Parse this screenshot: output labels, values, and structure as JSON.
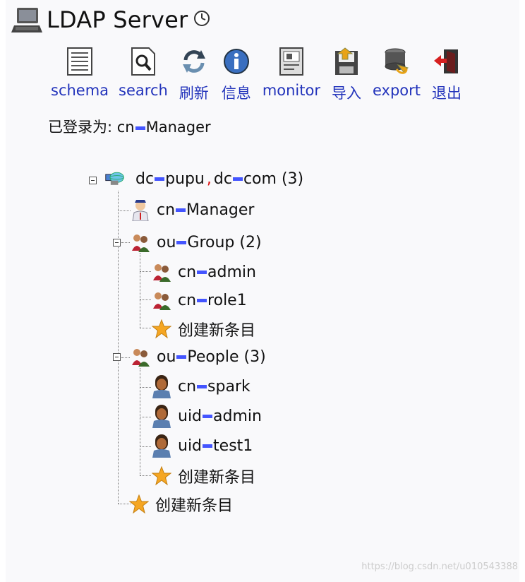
{
  "header": {
    "title": "LDAP Server"
  },
  "toolbar": {
    "items": [
      {
        "label": "schema",
        "icon": "schema-icon"
      },
      {
        "label": "search",
        "icon": "search-icon"
      },
      {
        "label": "刷新",
        "icon": "refresh-icon"
      },
      {
        "label": "信息",
        "icon": "info-icon"
      },
      {
        "label": "monitor",
        "icon": "monitor-icon"
      },
      {
        "label": "导入",
        "icon": "import-icon"
      },
      {
        "label": "export",
        "icon": "export-icon"
      },
      {
        "label": "退出",
        "icon": "logout-icon"
      }
    ]
  },
  "session": {
    "prefix": "已登录为: ",
    "user_attr": "cn",
    "user_value": "Manager"
  },
  "tree": {
    "root": {
      "attr1": "dc",
      "val1": "pupu",
      "attr2": "dc",
      "val2": "com",
      "count": "(3)"
    },
    "manager": {
      "attr": "cn",
      "value": "Manager"
    },
    "group": {
      "attr": "ou",
      "value": "Group",
      "count": "(2)"
    },
    "group_admin": {
      "attr": "cn",
      "value": "admin"
    },
    "group_role1": {
      "attr": "cn",
      "value": "role1"
    },
    "people": {
      "attr": "ou",
      "value": "People",
      "count": "(3)"
    },
    "people_spark": {
      "attr": "cn",
      "value": "spark"
    },
    "people_admin": {
      "attr": "uid",
      "value": "admin"
    },
    "people_test1": {
      "attr": "uid",
      "value": "test1"
    },
    "create_label": "创建新条目"
  },
  "watermark": "https://blog.csdn.net/u010543388",
  "colors": {
    "link": "#2233bb",
    "equals": "#4455ff",
    "comma": "#e01010"
  }
}
